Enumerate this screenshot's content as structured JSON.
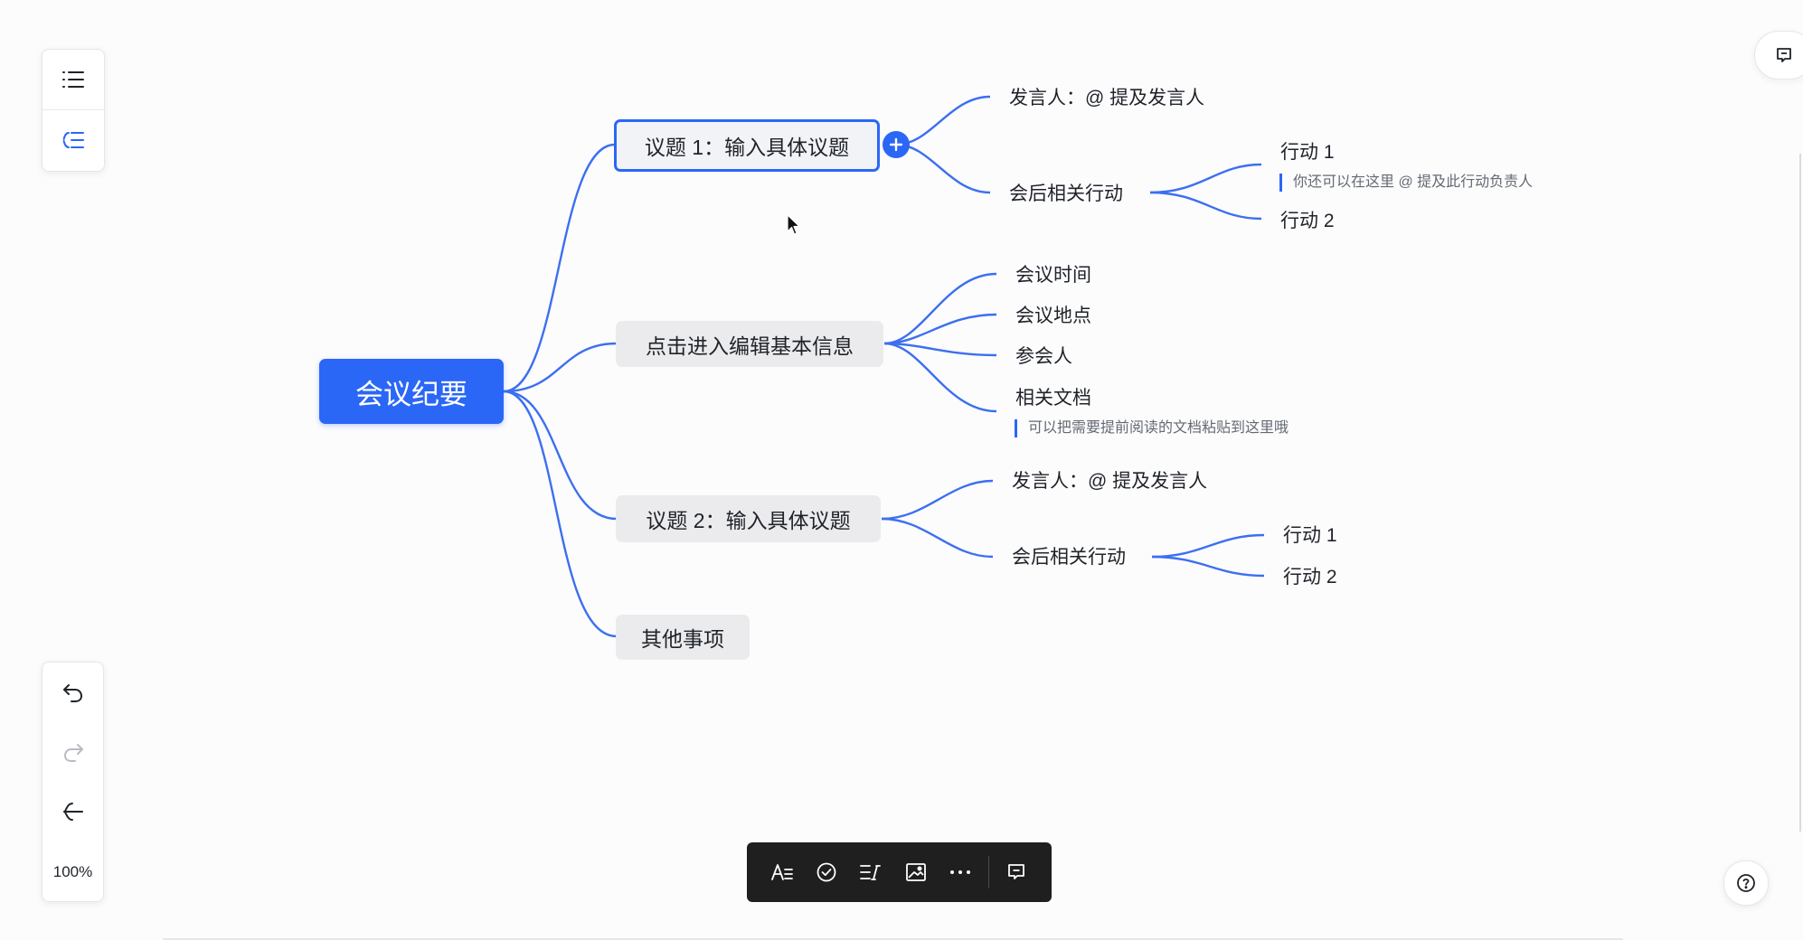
{
  "mindmap": {
    "root": "会议纪要",
    "topic1": {
      "label": "议题 1：输入具体议题",
      "speaker": "发言人：@ 提及发言人",
      "action_group": "会后相关行动",
      "action1": "行动 1",
      "action1_note": "你还可以在这里 @ 提及此行动负责人",
      "action2": "行动 2"
    },
    "topic_info": {
      "label": "点击进入编辑基本信息",
      "time": "会议时间",
      "place": "会议地点",
      "attendees": "参会人",
      "docs": "相关文档",
      "docs_note": "可以把需要提前阅读的文档粘贴到这里哦"
    },
    "topic2": {
      "label": "议题 2：输入具体议题",
      "speaker": "发言人：@ 提及发言人",
      "action_group": "会后相关行动",
      "action1": "行动 1",
      "action2": "行动 2"
    },
    "topic_other": {
      "label": "其他事项"
    }
  },
  "zoom": "100%",
  "icons": {
    "left_panel": [
      "outline-list-icon",
      "mindmap-structure-icon"
    ],
    "history": [
      "undo-icon",
      "redo-icon",
      "collapse-left-icon"
    ],
    "toolbar": [
      "text-style-icon",
      "task-check-icon",
      "note-icon",
      "image-icon",
      "more-icon",
      "comment-icon"
    ],
    "top_right": "comment-icon",
    "help": "help-icon"
  },
  "colors": {
    "accent": "#2b67f6",
    "toolbar_bg": "#1f1f1f",
    "topic_bg": "#ebebed"
  }
}
